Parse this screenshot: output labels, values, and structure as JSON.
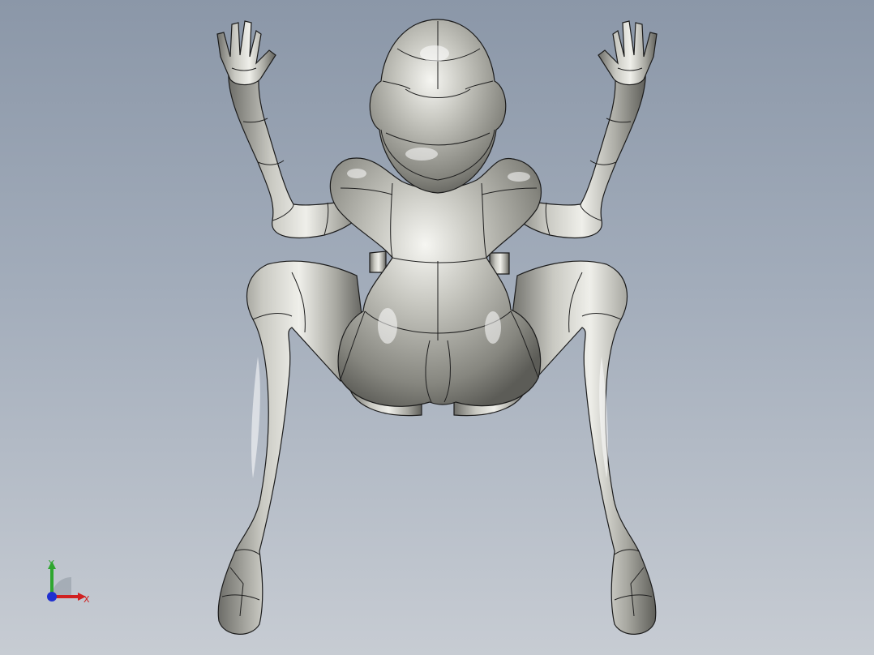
{
  "viewport": {
    "background_top": "#8b97a8",
    "background_bottom": "#c7ccd3",
    "model_color": "#b9b9b2"
  },
  "triad": {
    "x_label": "X",
    "y_label": "Y",
    "x_color": "#d02020",
    "y_color": "#2fa62f",
    "z_color": "#2030d0"
  }
}
